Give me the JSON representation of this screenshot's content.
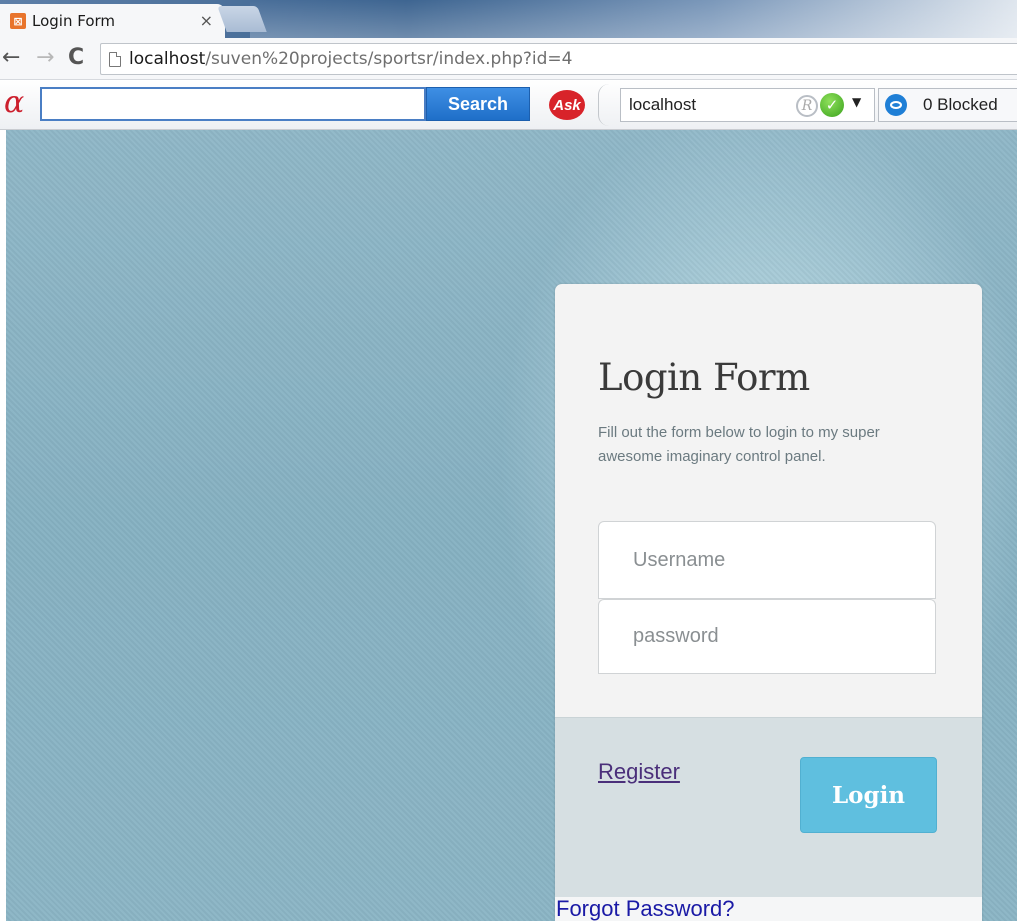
{
  "browser": {
    "tab": {
      "title": "Login Form",
      "close": "×"
    },
    "nav": {
      "back": "←",
      "forward": "→",
      "reload": "C"
    },
    "url": {
      "host": "localhost",
      "path": "/suven%20projects/sportsr/index.php?id=4"
    }
  },
  "toolbar": {
    "search_value": "",
    "search_button": "Search",
    "ask_label": "Ask",
    "site_field": "localhost",
    "blocked_label": "0 Blocked"
  },
  "form": {
    "title": "Login Form",
    "description": "Fill out the form below to login to my super awesome imaginary control panel.",
    "username_placeholder": "Username",
    "password_placeholder": "password",
    "register_label": "Register",
    "login_label": "Login",
    "forgot_label": "Forgot Password?"
  },
  "colors": {
    "background": "#8bb5c5",
    "card": "#f3f3f3",
    "footer": "#d6dfe2",
    "login_button": "#5fbfdf",
    "register_link": "#4a2f7a",
    "forgot_link": "#1a1aa6"
  }
}
